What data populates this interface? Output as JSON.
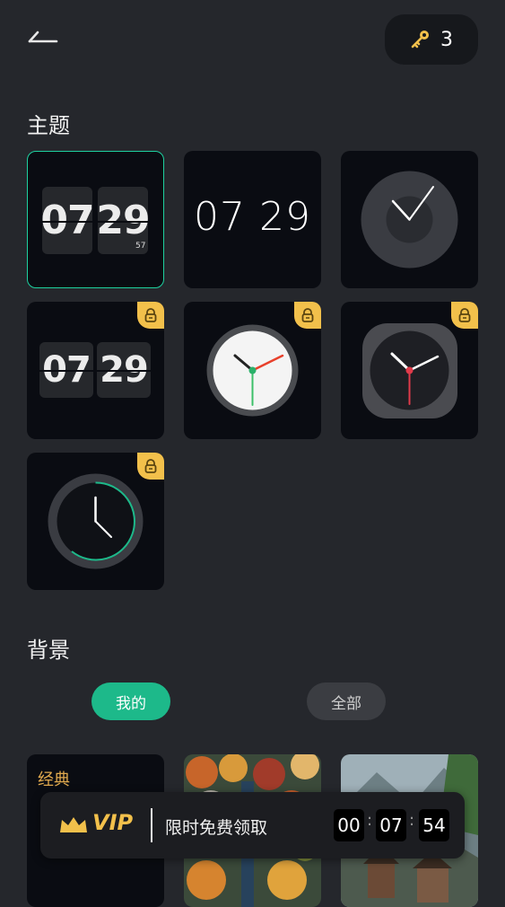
{
  "header": {
    "back_icon": "back-arrow-icon",
    "key_icon": "key-icon",
    "key_count": "3"
  },
  "themes": {
    "title": "主题",
    "items": [
      {
        "name": "flip-clock-seconds",
        "hour": "07",
        "minute": "29",
        "second": "57",
        "locked": false,
        "selected": true
      },
      {
        "name": "digital-thin",
        "time": "07 29",
        "locked": false
      },
      {
        "name": "analog-minimal",
        "locked": false
      },
      {
        "name": "flip-clock",
        "hour": "07",
        "minute": "29",
        "locked": true
      },
      {
        "name": "analog-white",
        "locked": true
      },
      {
        "name": "analog-dark-square",
        "locked": true
      },
      {
        "name": "analog-ring",
        "locked": true
      }
    ],
    "lock_icon": "lock-icon"
  },
  "background": {
    "title": "背景",
    "tabs": [
      {
        "label": "我的",
        "active": true
      },
      {
        "label": "全部",
        "active": false
      }
    ],
    "cards": [
      {
        "label": "经典"
      },
      {
        "name": "autumn-forest-aerial"
      },
      {
        "name": "alpine-village"
      }
    ]
  },
  "vip_bar": {
    "badge": "VIP",
    "text": "限时免费领取",
    "timer": {
      "hours": "00",
      "minutes": "07",
      "seconds": "54"
    }
  },
  "colors": {
    "accent": "#1db98a",
    "lock": "#f2c04b",
    "card_bg": "#0a0c12",
    "page_bg": "#25272c"
  }
}
